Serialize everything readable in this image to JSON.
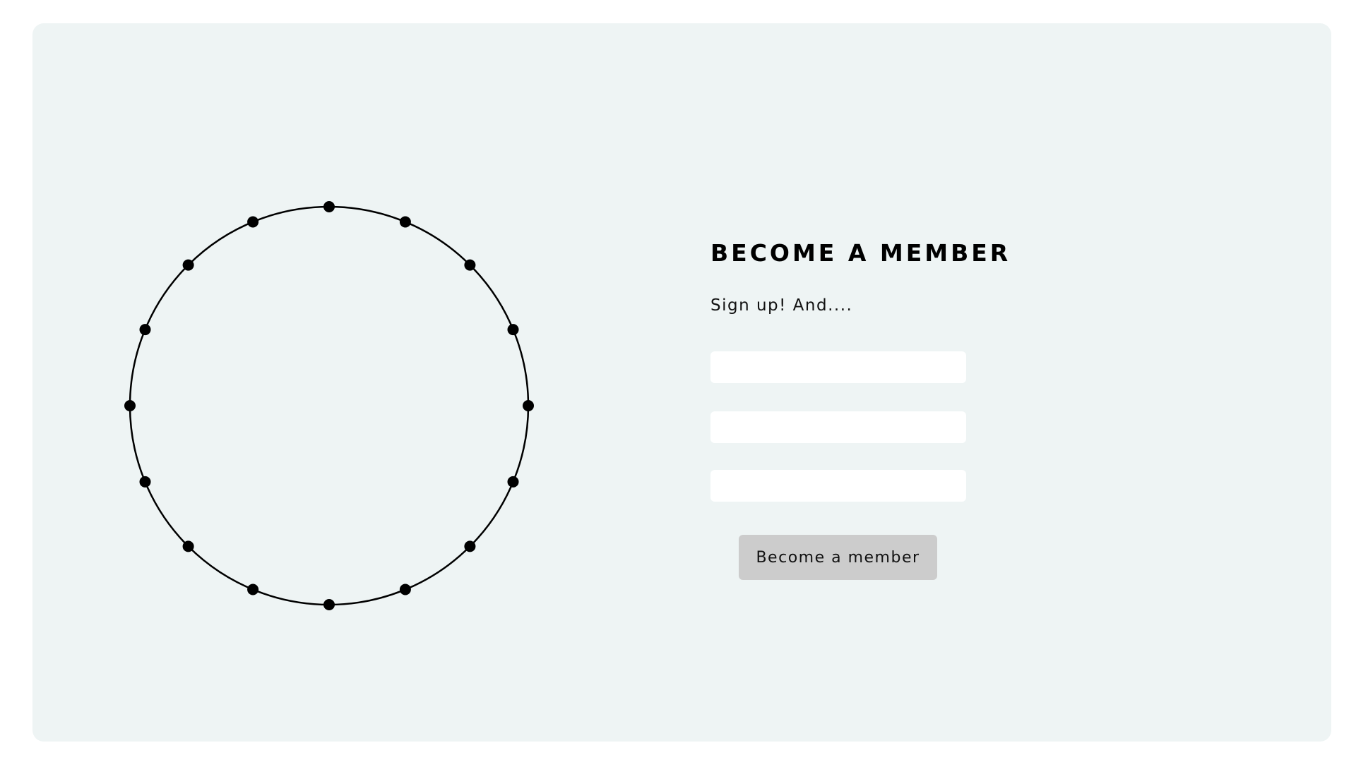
{
  "form": {
    "title": "BECOME A MEMBER",
    "subtitle": "Sign up! And....",
    "fields": [
      {
        "value": "",
        "placeholder": ""
      },
      {
        "value": "",
        "placeholder": ""
      },
      {
        "value": "",
        "placeholder": ""
      }
    ],
    "submit_label": "Become a member"
  },
  "decoration": {
    "dot_count": 16,
    "stroke_color": "#000000"
  },
  "colors": {
    "panel_background": "#eef4f4",
    "field_background": "#ffffff",
    "button_background": "#cccccc",
    "text": "#000000"
  }
}
